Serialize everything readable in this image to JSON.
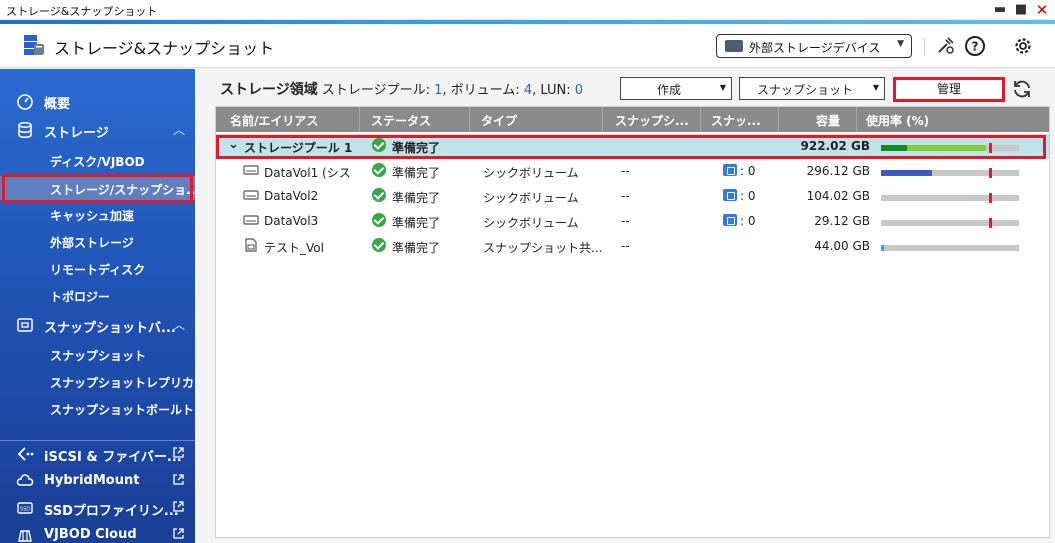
{
  "window": {
    "title": "ストレージ&スナップショット"
  },
  "header": {
    "app_title": "ストレージ&スナップショット",
    "external_device_label": "外部ストレージデバイス"
  },
  "sidebar": {
    "overview": "概要",
    "storage": "ストレージ",
    "storage_sub": [
      "ディスク/VJBOD",
      "ストレージ/スナップショ...",
      "キャッシュ加速",
      "外部ストレージ",
      "リモートディスク",
      "トポロジー"
    ],
    "snapshot_backup": "スナップショットバ...",
    "snapshot_sub": [
      "スナップショット",
      "スナップショットレプリカ",
      "スナップショットボールト"
    ],
    "iscsi": "iSCSI & ファイバー...",
    "hybridmount": "HybridMount",
    "ssd_profiling": "SSDプロファイリン...",
    "vjbod_cloud": "VJBOD Cloud"
  },
  "toolbar": {
    "section_title": "ストレージ領域",
    "pool_label": "ストレージプール:",
    "pool_count": "1",
    "volume_label": ", ボリューム:",
    "volume_count": "4",
    "lun_label": ", LUN:",
    "lun_count": "0",
    "create_label": "作成",
    "snapshot_label": "スナップショット",
    "manage_label": "管理"
  },
  "table": {
    "columns": [
      "名前/エイリアス",
      "ステータス",
      "タイプ",
      "スナップシ...",
      "スナッ...",
      "容量",
      "使用率 (%)"
    ],
    "pool": {
      "name": "ストレージプール 1",
      "status": "準備完了",
      "capacity": "922.02 GB",
      "usage_dark": 0.19,
      "usage_light": 0.57
    },
    "rows": [
      {
        "name": "DataVol1 (シス...",
        "status": "準備完了",
        "type": "シックボリューム",
        "snap1": "--",
        "snap2": ": 0",
        "capacity": "296.12 GB",
        "usage": 0.37
      },
      {
        "name": "DataVol2",
        "status": "準備完了",
        "type": "シックボリューム",
        "snap1": "--",
        "snap2": ": 0",
        "capacity": "104.02 GB",
        "usage": 0.0
      },
      {
        "name": "DataVol3",
        "status": "準備完了",
        "type": "シックボリューム",
        "snap1": "--",
        "snap2": ": 0",
        "capacity": "29.12 GB",
        "usage": 0.0
      },
      {
        "name": "テスト_Vol",
        "status": "準備完了",
        "type": "スナップショット共...",
        "snap1": "--",
        "snap2": "",
        "capacity": "44.00 GB",
        "usage": 0.02
      }
    ]
  },
  "colors": {
    "accent": "#1f4fb0",
    "highlight": "#e0192b",
    "ok": "#3aa64a",
    "pool_row": "#bfe3e8"
  }
}
